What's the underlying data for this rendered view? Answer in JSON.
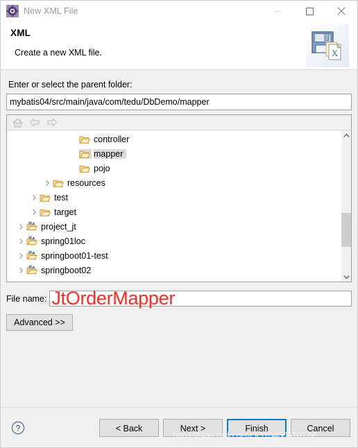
{
  "window": {
    "title": "New XML File",
    "title_icon": "xml-gear-icon",
    "controls": {
      "minimize": "minimize-icon",
      "maximize": "maximize-icon",
      "close": "close-icon"
    }
  },
  "header": {
    "title": "XML",
    "subtitle": "Create a new XML file.",
    "icon": "floppy-disk-xml-icon"
  },
  "parent_folder": {
    "label": "Enter or select the parent folder:",
    "value": "mybatis04/src/main/java/com/tedu/DbDemo/mapper",
    "placeholder": ""
  },
  "tree": {
    "toolbar": [
      {
        "name": "home-icon",
        "glyph": "home"
      },
      {
        "name": "back-arrow-icon",
        "glyph": "back"
      },
      {
        "name": "forward-arrow-icon",
        "glyph": "forward"
      }
    ],
    "rows": [
      {
        "label": "controller",
        "indent": 4,
        "icon": "folder-icon",
        "twisty": "",
        "selected": false
      },
      {
        "label": "mapper",
        "indent": 4,
        "icon": "folder-icon",
        "twisty": "",
        "selected": true
      },
      {
        "label": "pojo",
        "indent": 4,
        "icon": "folder-icon",
        "twisty": "",
        "selected": false
      },
      {
        "label": "resources",
        "indent": 2,
        "icon": "folder-icon",
        "twisty": ">",
        "selected": false
      },
      {
        "label": "test",
        "indent": 1,
        "icon": "folder-icon",
        "twisty": ">",
        "selected": false
      },
      {
        "label": "target",
        "indent": 1,
        "icon": "folder-icon",
        "twisty": ">",
        "selected": false
      },
      {
        "label": "project_jt",
        "indent": 0,
        "icon": "maven-project-icon",
        "twisty": ">",
        "selected": false
      },
      {
        "label": "spring01loc",
        "indent": 0,
        "icon": "maven-project-icon",
        "twisty": ">",
        "selected": false
      },
      {
        "label": "springboot01-test",
        "indent": 0,
        "icon": "maven-project-icon",
        "twisty": ">",
        "selected": false
      },
      {
        "label": "springboot02",
        "indent": 0,
        "icon": "maven-project-icon",
        "twisty": ">",
        "selected": false
      }
    ],
    "scrollbar": {
      "up": "scroll-up-arrow-icon",
      "down": "scroll-down-arrow-icon"
    }
  },
  "file_name": {
    "label": "File name:",
    "value": "JtOrderMapper",
    "value_color": "#ff2a23",
    "placeholder": ""
  },
  "advanced": {
    "label": "Advanced >>"
  },
  "footer": {
    "help_icon": "help-question-icon",
    "buttons": [
      {
        "label": "< Back",
        "name": "back-button",
        "default": false
      },
      {
        "label": "Next >",
        "name": "next-button",
        "default": false
      },
      {
        "label": "Finish",
        "name": "finish-button",
        "default": true
      },
      {
        "label": "Cancel",
        "name": "cancel-button",
        "default": false
      }
    ]
  },
  "watermark": {
    "text": "https://blog.csdn.net/QQ104605101?2"
  },
  "colors": {
    "accent": "#0078d7",
    "folder": "#e8a33d",
    "selection": "#dcdcdc",
    "title_text": "#9a9a9a",
    "annotation": "#ff2a23"
  }
}
